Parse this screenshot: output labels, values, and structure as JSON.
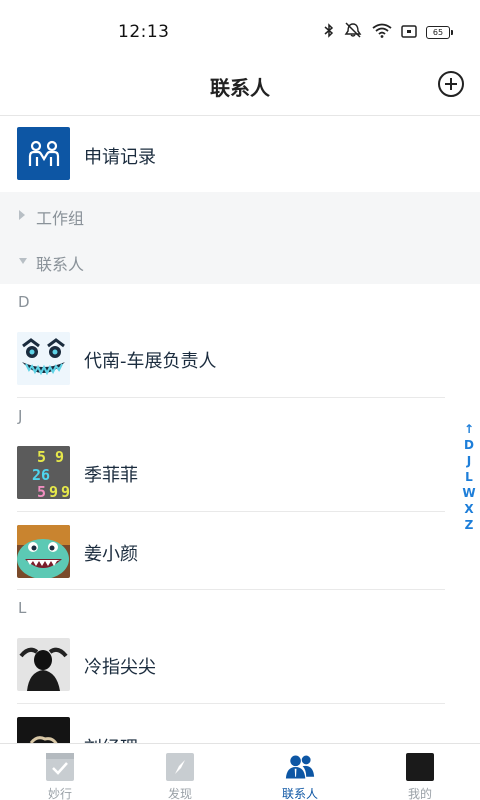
{
  "status_bar": {
    "time": "12:13",
    "battery": "65",
    "icons": [
      "bluetooth-icon",
      "mute-icon",
      "wifi-icon",
      "sim-icon",
      "battery-icon"
    ]
  },
  "header": {
    "title": "联系人",
    "add_icon": "plus-circle-icon"
  },
  "apply_record": {
    "label": "申请记录",
    "icon_color": "#0d56a4"
  },
  "groups": [
    {
      "label": "工作组",
      "expanded": false
    },
    {
      "label": "联系人",
      "expanded": true
    }
  ],
  "sections": [
    {
      "letter": "D",
      "contacts": [
        {
          "name": "代南-车展负责人"
        }
      ]
    },
    {
      "letter": "J",
      "contacts": [
        {
          "name": "季菲菲"
        },
        {
          "name": "姜小颜"
        }
      ]
    },
    {
      "letter": "L",
      "contacts": [
        {
          "name": "冷指尖尖"
        },
        {
          "name": "刘经理"
        }
      ]
    }
  ],
  "avatar_26_text": [
    "5",
    "9",
    "26",
    "5",
    "9",
    "9"
  ],
  "index_bar": [
    "↑",
    "D",
    "J",
    "L",
    "W",
    "X",
    "Z"
  ],
  "tabs": [
    {
      "label": "妙行",
      "active": false
    },
    {
      "label": "发现",
      "active": false
    },
    {
      "label": "联系人",
      "active": true
    },
    {
      "label": "我的",
      "active": false
    }
  ],
  "colors": {
    "accent": "#0d56a4",
    "index": "#1d7ed9",
    "muted": "#8a9299"
  }
}
